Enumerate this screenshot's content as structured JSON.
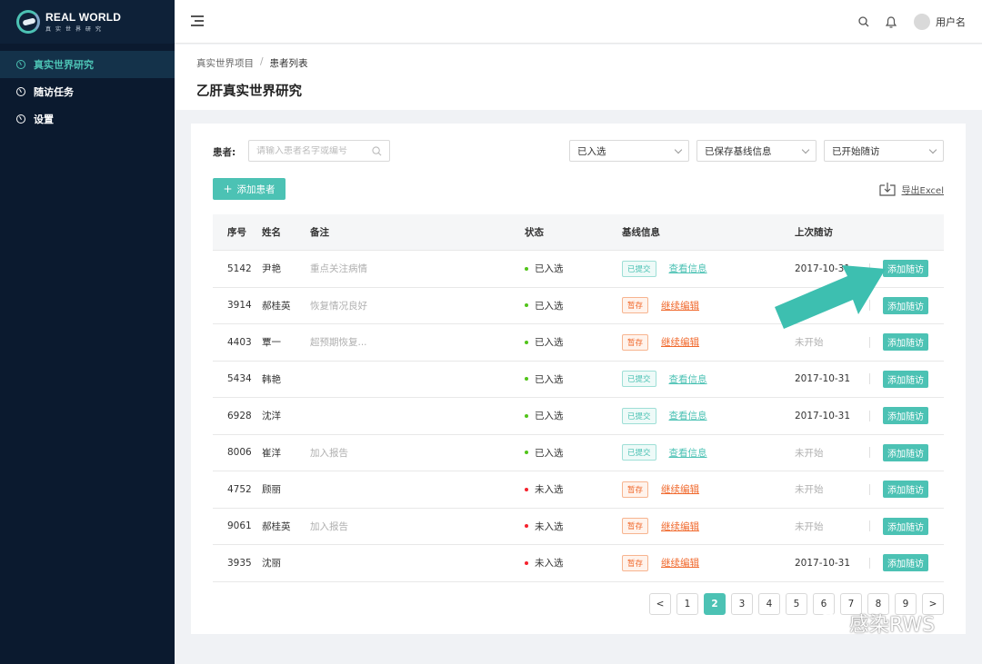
{
  "brand": {
    "title": "REAL WORLD",
    "subtitle": "真实世界研究"
  },
  "sidebar": {
    "items": [
      {
        "label": "真实世界研究",
        "active": true
      },
      {
        "label": "随访任务",
        "active": false
      },
      {
        "label": "设置",
        "active": false
      }
    ]
  },
  "header": {
    "username": "用户名"
  },
  "breadcrumb": {
    "parent": "真实世界项目",
    "separator": "/",
    "current": "患者列表"
  },
  "page_title": "乙肝真实世界研究",
  "filters": {
    "patient_label": "患者:",
    "search_placeholder": "请输入患者名字或编号",
    "select_enroll": "已入选",
    "select_baseline": "已保存基线信息",
    "select_followup": "已开始随访"
  },
  "toolbar": {
    "add_patient": "添加患者",
    "add_icon": "+",
    "export": "导出Excel"
  },
  "table": {
    "headers": {
      "id": "序号",
      "name": "姓名",
      "note": "备注",
      "status": "状态",
      "baseline": "基线信息",
      "last_visit": "上次随访"
    },
    "rows": [
      {
        "id": "5142",
        "name": "尹艳",
        "note": "重点关注病情",
        "status": "已入选",
        "tag": "已提交",
        "link": "查看信息",
        "last": "2017-10-31",
        "action": "添加随访"
      },
      {
        "id": "3914",
        "name": "郝桂英",
        "note": "恢复情况良好",
        "status": "已入选",
        "tag": "暂存",
        "link": "继续编辑",
        "last": "",
        "action": "添加随访"
      },
      {
        "id": "4403",
        "name": "覃一",
        "note": "超预期恢复...",
        "status": "已入选",
        "tag": "暂存",
        "link": "继续编辑",
        "last": "未开始",
        "action": "添加随访"
      },
      {
        "id": "5434",
        "name": "韩艳",
        "note": "",
        "status": "已入选",
        "tag": "已提交",
        "link": "查看信息",
        "last": "2017-10-31",
        "action": "添加随访"
      },
      {
        "id": "6928",
        "name": "沈洋",
        "note": "",
        "status": "已入选",
        "tag": "已提交",
        "link": "查看信息",
        "last": "2017-10-31",
        "action": "添加随访"
      },
      {
        "id": "8006",
        "name": "崔洋",
        "note": "加入报告",
        "status": "已入选",
        "tag": "已提交",
        "link": "查看信息",
        "last": "未开始",
        "action": "添加随访"
      },
      {
        "id": "4752",
        "name": "顾丽",
        "note": "",
        "status": "未入选",
        "tag": "暂存",
        "link": "继续编辑",
        "last": "未开始",
        "action": "添加随访"
      },
      {
        "id": "9061",
        "name": "郝桂英",
        "note": "加入报告",
        "status": "未入选",
        "tag": "暂存",
        "link": "继续编辑",
        "last": "未开始",
        "action": "添加随访"
      },
      {
        "id": "3935",
        "name": "沈丽",
        "note": "",
        "status": "未入选",
        "tag": "暂存",
        "link": "继续编辑",
        "last": "2017-10-31",
        "action": "添加随访"
      }
    ]
  },
  "pagination": {
    "prev": "<",
    "next": ">",
    "pages": [
      "1",
      "2",
      "3",
      "4",
      "5",
      "6",
      "7",
      "8",
      "9"
    ],
    "current": "2"
  },
  "watermark": "感染RWS",
  "colors": {
    "accent": "#4cc2b4",
    "draft": "#f0692d",
    "sidebar_bg": "#0b1a2f",
    "status_ok": "#52c41a",
    "status_no": "#f5222d"
  }
}
